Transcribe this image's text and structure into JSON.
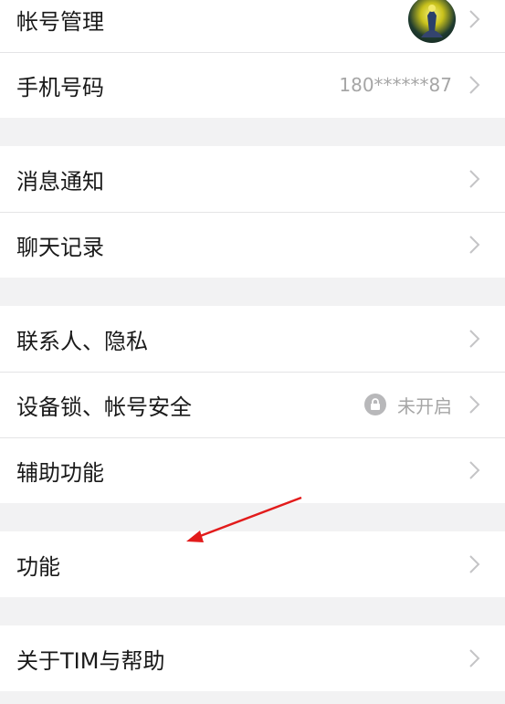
{
  "group1": {
    "account": {
      "label": "帐号管理",
      "icon": "avatar"
    },
    "phone": {
      "label": "手机号码",
      "value": "180******87"
    }
  },
  "group2": {
    "notifications": {
      "label": "消息通知"
    },
    "chat_history": {
      "label": "聊天记录"
    }
  },
  "group3": {
    "contacts_privacy": {
      "label": "联系人、隐私"
    },
    "device_lock": {
      "label": "设备锁、帐号安全",
      "value": "未开启",
      "icon": "lock-icon"
    },
    "accessibility": {
      "label": "辅助功能"
    }
  },
  "group4": {
    "features": {
      "label": "功能"
    }
  },
  "group5": {
    "about": {
      "label": "关于TIM与帮助"
    }
  },
  "colors": {
    "annotation_arrow": "#e21b1b",
    "chevron": "#c4c4c6",
    "background": "#f2f2f3"
  }
}
